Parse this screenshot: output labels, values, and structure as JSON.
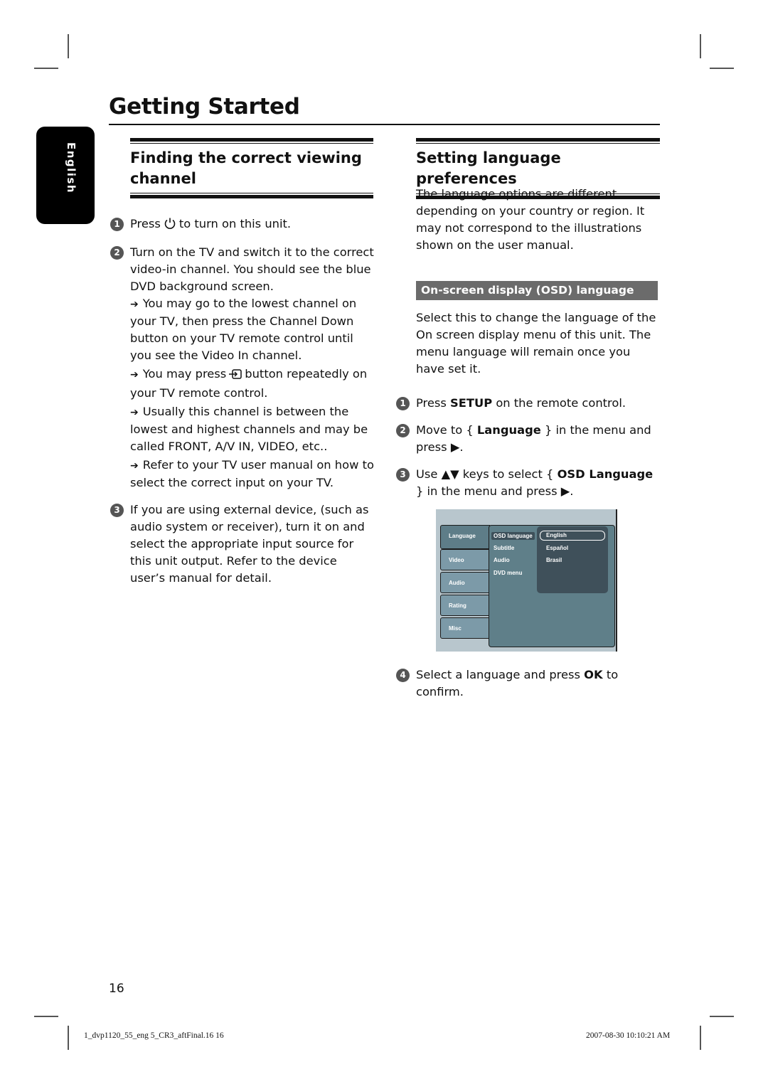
{
  "page": {
    "title": "Getting Started",
    "language_tab": "English",
    "page_number": "16"
  },
  "left_section": {
    "heading": "Finding the correct viewing channel",
    "steps": [
      {
        "num": "1",
        "before": "Press",
        "icon": "power-icon",
        "after": "to turn on this unit."
      },
      {
        "num": "2",
        "text": "Turn on the TV and switch it to the correct video-in channel. You should see the blue DVD background screen."
      },
      {
        "num": "3",
        "text": "If you are using external device, (such as audio system or receiver), turn it on and select the appropriate input source for this unit output. Refer to the device user’s manual for detail."
      }
    ],
    "notes": [
      "You may go to the lowest channel on your TV, then press the Channel Down button on your TV remote control until you see the Video In channel.",
      {
        "before": "You may press",
        "icon": "input-source-icon",
        "after": "button repeatedly on your TV remote control."
      },
      "Usually this channel is between the lowest and highest channels and may be called FRONT, A/V IN, VIDEO, etc..",
      "Refer to your TV user manual on how to select the correct input on your TV."
    ],
    "note_arrow": "➔"
  },
  "right_section": {
    "heading": "Setting language preferences",
    "intro": "The language options are different depending on your country or region. It may not correspond to the illustrations shown on the user manual.",
    "subheading": "On-screen display (OSD) language",
    "description": "Select this to change the language of the On screen display menu of this unit. The menu language will remain once you have set it.",
    "steps": [
      {
        "num": "1",
        "t1": "Press ",
        "b1": "SETUP",
        "t2": " on the remote control."
      },
      {
        "num": "2",
        "t1": "Move to { ",
        "b1": "Language",
        "t2": " } in the menu and press ▶."
      },
      {
        "num": "3",
        "t1": "Use ▲▼ keys to select { ",
        "b1": "OSD Language",
        "t2": " } in the menu and press ▶."
      },
      {
        "num": "4",
        "t1": "Select a language and press ",
        "b1": "OK",
        "t2": " to confirm."
      }
    ]
  },
  "osd_menu": {
    "tabs": [
      "Language",
      "Video",
      "Audio",
      "Rating",
      "Misc"
    ],
    "active_tab": "Language",
    "items": [
      "OSD language",
      "Subtitle",
      "Audio",
      "DVD menu"
    ],
    "selected_item": "OSD language",
    "options": [
      "English",
      "Español",
      "Brasil"
    ],
    "current_option": "English",
    "colors": {
      "background": "#b8c6cd",
      "panel": "#5f7f89",
      "options_box": "#3f505a",
      "tab": "#7c9aa8"
    }
  },
  "footer": {
    "file": "1_dvp1120_55_eng 5_CR3_aftFinal.16   16",
    "timestamp": "2007-08-30   10:10:21 AM"
  },
  "colors": {
    "subheading_bg": "#6b6b6b",
    "badge": "#555555",
    "text": "#111111"
  }
}
